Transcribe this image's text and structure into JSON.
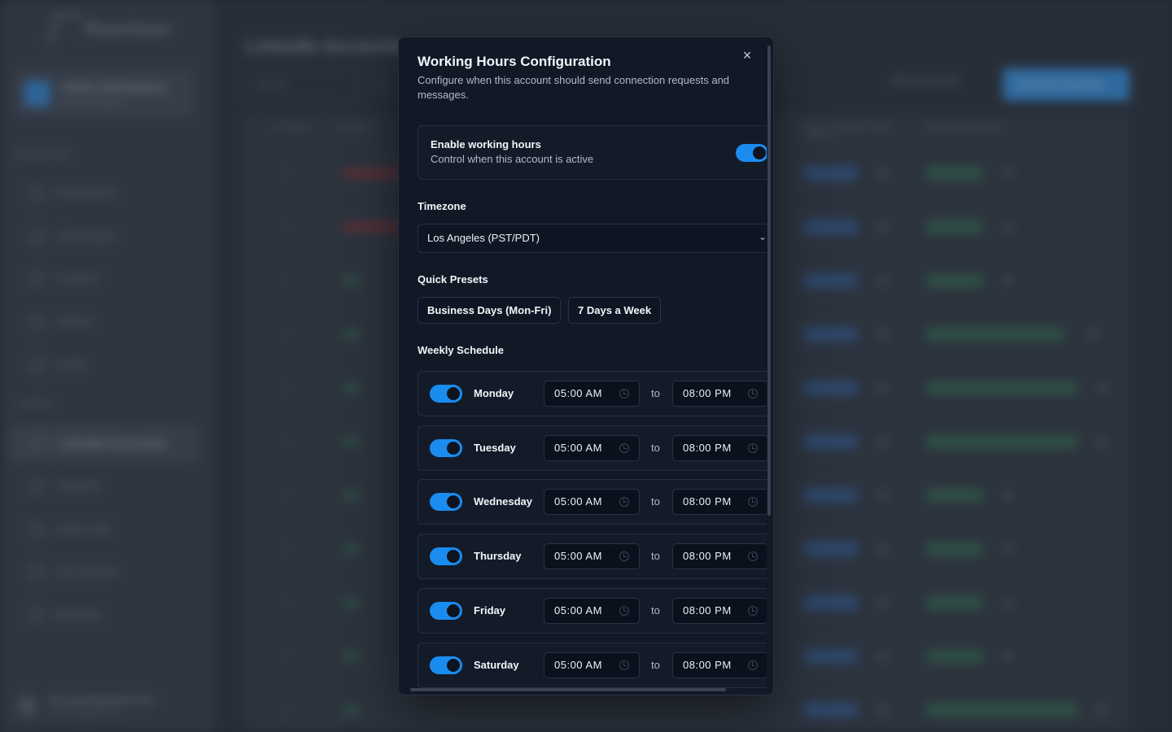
{
  "background": {
    "logo_text": "Reachium",
    "workspace": {
      "name": "Admin Workspace",
      "sub": "Active Workspace"
    },
    "sections": [
      "MARKETING",
      "ASSETS"
    ],
    "nav": [
      "Dashboard",
      "Campaigns",
      "Content",
      "Unibox",
      "Learn",
      "LinkedIn Accounts",
      "Network",
      "Lead Lists",
      "Documents",
      "Booking"
    ],
    "user": {
      "name": "lessonai@gmail.com",
      "email": "lessonai@gmail.com"
    },
    "page_title": "LinkedIn Accounts",
    "search_placeholder": "Search",
    "filter": "All",
    "ban_button": "Ban Account",
    "add_button": "Connect Account",
    "columns": [
      "ACTIONS",
      "STATUS",
      "DAILY CONNECTION LIMITS",
      "WORKING HOURS"
    ]
  },
  "modal": {
    "title": "Working Hours Configuration",
    "description": "Configure when this account should send connection requests and messages.",
    "close_symbol": "×",
    "enable": {
      "title": "Enable working hours",
      "subtitle": "Control when this account is active",
      "enabled": true
    },
    "timezone": {
      "label": "Timezone",
      "value": "Los Angeles (PST/PDT)",
      "chevron": "⌄"
    },
    "presets": {
      "label": "Quick Presets",
      "buttons": [
        "Business Days (Mon-Fri)",
        "7 Days a Week"
      ]
    },
    "schedule": {
      "label": "Weekly Schedule",
      "separator": "to",
      "days": [
        {
          "name": "Monday",
          "enabled": true,
          "start": "05:00 AM",
          "end": "08:00 PM"
        },
        {
          "name": "Tuesday",
          "enabled": true,
          "start": "05:00 AM",
          "end": "08:00 PM"
        },
        {
          "name": "Wednesday",
          "enabled": true,
          "start": "05:00 AM",
          "end": "08:00 PM"
        },
        {
          "name": "Thursday",
          "enabled": true,
          "start": "05:00 AM",
          "end": "08:00 PM"
        },
        {
          "name": "Friday",
          "enabled": true,
          "start": "05:00 AM",
          "end": "08:00 PM"
        },
        {
          "name": "Saturday",
          "enabled": true,
          "start": "05:00 AM",
          "end": "08:00 PM"
        }
      ]
    }
  },
  "colors": {
    "accent": "#1a8cf0",
    "modal_bg": "#111826",
    "backdrop": "#333a45"
  }
}
